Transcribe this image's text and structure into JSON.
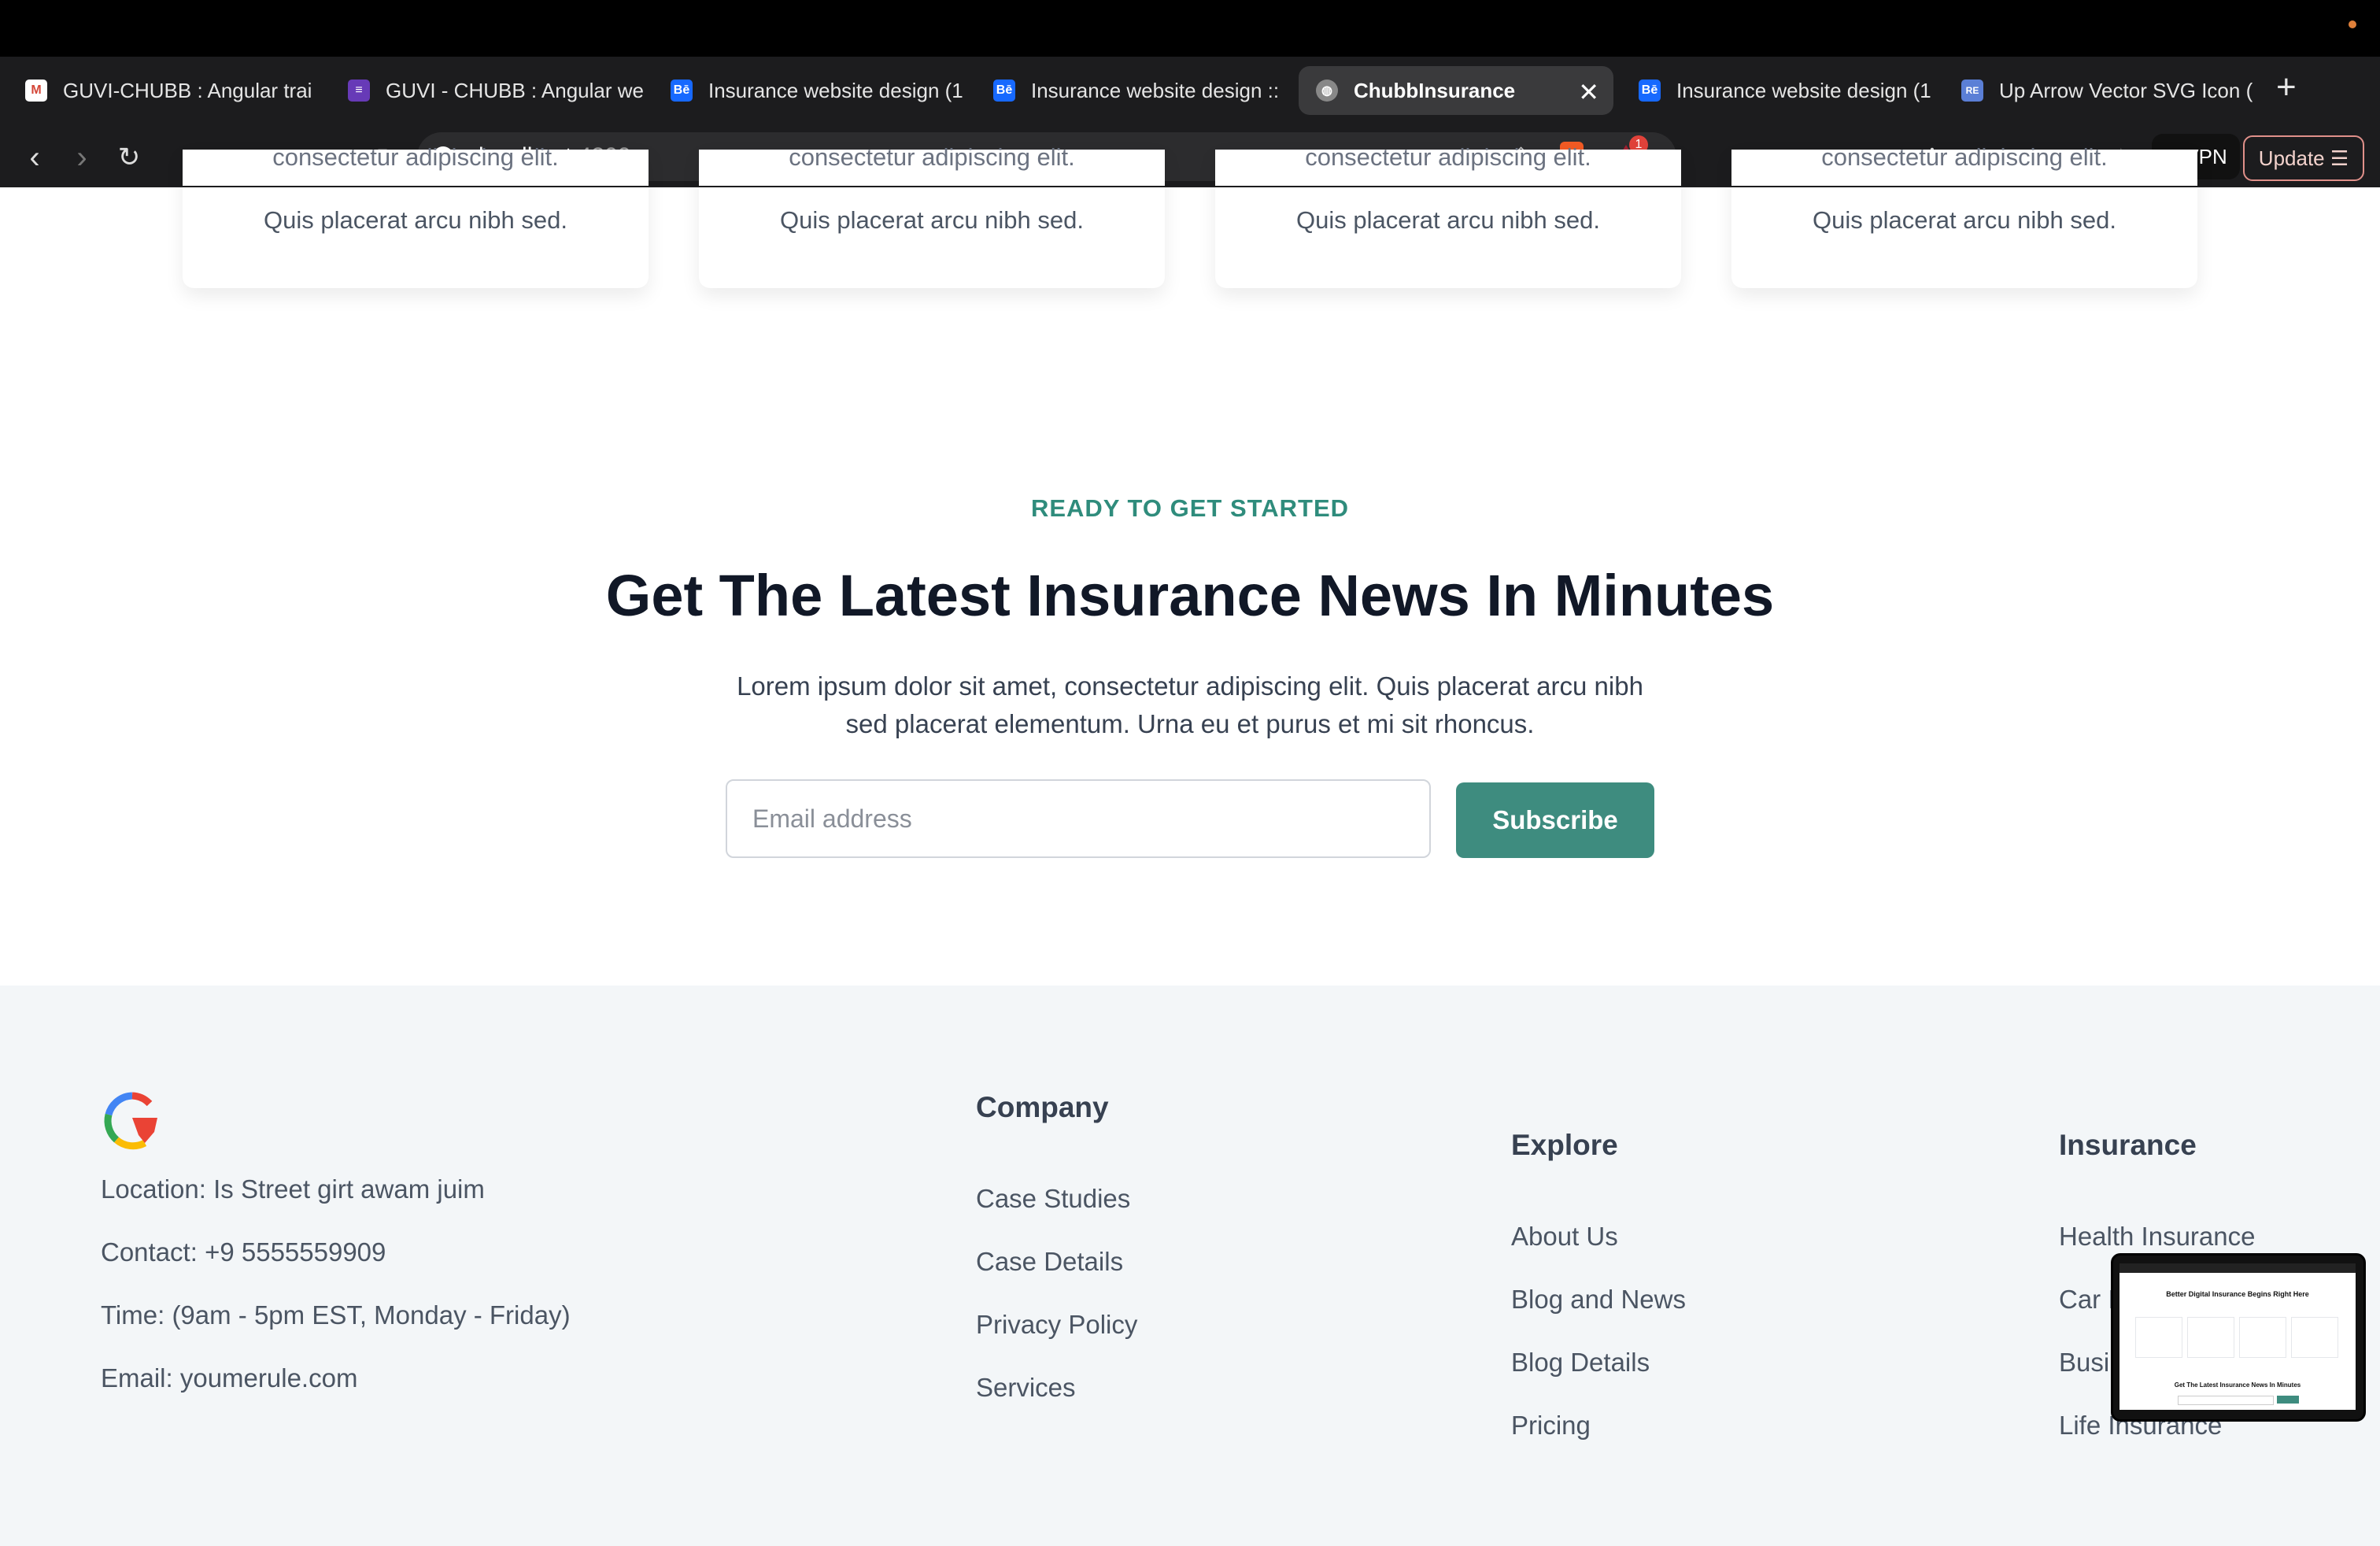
{
  "browser": {
    "tabs": [
      {
        "label": "GUVI-CHUBB : Angular trai",
        "icon": "gmail-icon",
        "color": "#d44638"
      },
      {
        "label": "GUVI - CHUBB : Angular we",
        "icon": "forms-icon",
        "color": "#673ab7"
      },
      {
        "label": "Insurance website design (1",
        "icon": "behance-icon",
        "color": "#1769ff"
      },
      {
        "label": "Insurance website design ::",
        "icon": "behance-icon",
        "color": "#1769ff"
      },
      {
        "label": "ChubbInsurance",
        "icon": "globe-icon",
        "color": "#888888",
        "active": true
      },
      {
        "label": "Insurance website design (1",
        "icon": "behance-icon",
        "color": "#1769ff"
      },
      {
        "label": "Up Arrow Vector SVG Icon (",
        "icon": "svgrepo-icon",
        "color": "#5b7fd6"
      }
    ],
    "url_host": "localhost",
    "url_port": ":4200",
    "notification_count": "1",
    "vpn_label": "VPN",
    "update_label": "Update"
  },
  "cards": [
    {
      "line1": "consectetur adipiscing elit.",
      "line2": "Quis placerat arcu nibh sed."
    },
    {
      "line1": "consectetur adipiscing elit.",
      "line2": "Quis placerat arcu nibh sed."
    },
    {
      "line1": "consectetur adipiscing elit.",
      "line2": "Quis placerat arcu nibh sed."
    },
    {
      "line1": "consectetur adipiscing elit.",
      "line2": "Quis placerat arcu nibh sed."
    }
  ],
  "newsletter": {
    "eyebrow": "READY TO GET STARTED",
    "headline": "Get The Latest Insurance News In Minutes",
    "lead_line1": "Lorem ipsum dolor sit amet, consectetur adipiscing elit. Quis placerat arcu nibh",
    "lead_line2": "sed placerat elementum. Urna eu et purus et mi sit rhoncus.",
    "email_placeholder": "Email address",
    "subscribe_label": "Subscribe",
    "accent_color": "#3e8c7f"
  },
  "footer": {
    "location": "Location: Is Street girt awam juim",
    "contact": "Contact: +9 5555559909",
    "time": "Time: (9am - 5pm EST, Monday - Friday)",
    "email": "Email: youmerule.com",
    "company": {
      "heading": "Company",
      "links": [
        "Case Studies",
        "Case Details",
        "Privacy Policy",
        "Services"
      ]
    },
    "explore": {
      "heading": "Explore",
      "links": [
        "About Us",
        "Blog and News",
        "Blog Details",
        "Pricing"
      ]
    },
    "insurance": {
      "heading": "Insurance",
      "links": [
        "Health Insurance",
        "Car I",
        "Busi",
        "Life Insurance"
      ]
    }
  },
  "pip_preview": {
    "title": "Better Digital Insurance Begins Right Here",
    "subtitle": "Get The Latest Insurance News In Minutes"
  }
}
